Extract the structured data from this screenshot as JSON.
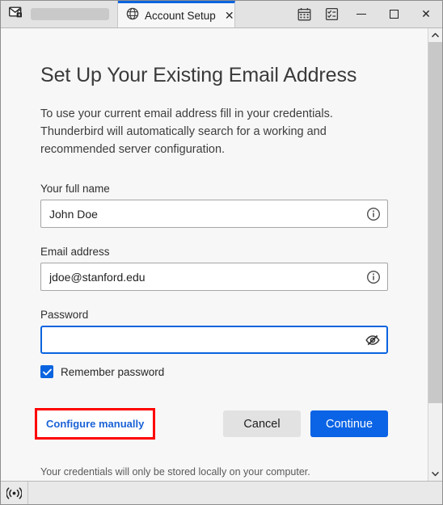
{
  "window": {
    "tabs": [
      {
        "name": "mail-tab",
        "icon": "mail-lock-icon",
        "label": "",
        "redacted": true
      },
      {
        "name": "account-setup-tab",
        "icon": "globe-icon",
        "label": "Account Setup",
        "close_glyph": "✕",
        "active": true
      }
    ],
    "toolbar_icons": [
      {
        "name": "calendar-icon",
        "label": "Calendar"
      },
      {
        "name": "tasks-icon",
        "label": "Tasks"
      }
    ],
    "controls": {
      "minimize": "minimize-button",
      "maximize": "maximize-button",
      "close": "close-button",
      "close_glyph": "✕"
    }
  },
  "main": {
    "title": "Set Up Your Existing Email Address",
    "description": "To use your current email address fill in your credentials. Thunderbird will automatically search for a working and recommended server configuration.",
    "fields": [
      {
        "name": "full-name",
        "label": "Your full name",
        "value": "John Doe",
        "placeholder": "",
        "icon": "info-icon",
        "focused": false
      },
      {
        "name": "email-address",
        "label": "Email address",
        "value": "jdoe@stanford.edu",
        "placeholder": "",
        "icon": "info-icon",
        "focused": false
      },
      {
        "name": "password",
        "label": "Password",
        "value": "",
        "placeholder": "",
        "icon": "eye-slash-icon",
        "focused": true
      }
    ],
    "remember_password": {
      "label": "Remember password",
      "checked": true
    },
    "configure_manually_label": "Configure manually",
    "cancel_label": "Cancel",
    "continue_label": "Continue",
    "footnote": "Your credentials will only be stored locally on your computer."
  },
  "statusbar": {
    "icon": "broadcast-icon"
  },
  "colors": {
    "accent_blue": "#0b63e5",
    "tab_active_border": "#0a64e0",
    "link_blue": "#1a62d6",
    "highlight_red": "#ff0000",
    "content_bg": "#f7f7f7",
    "chrome_bg": "#e3e3e3"
  }
}
